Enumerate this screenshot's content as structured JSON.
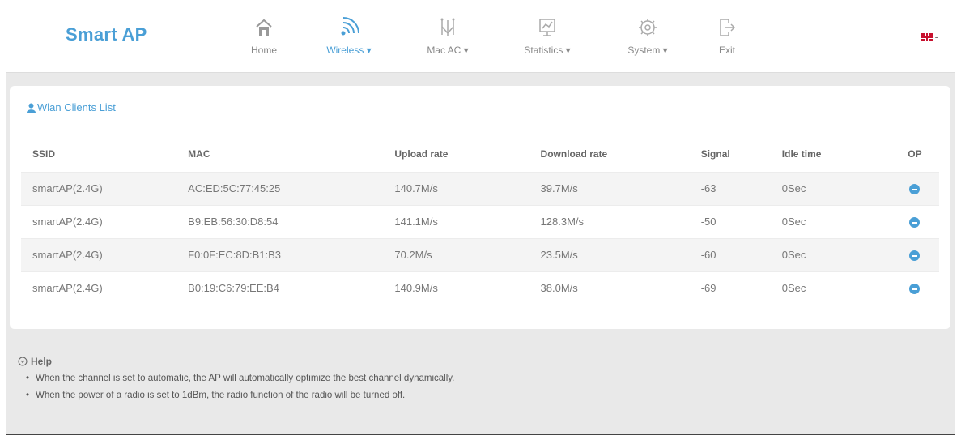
{
  "header": {
    "brand": "Smart AP",
    "nav": [
      {
        "label": "Home",
        "icon": "home-icon"
      },
      {
        "label": "Wireless ▾",
        "icon": "wifi-icon",
        "active": true
      },
      {
        "label": "Mac AC ▾",
        "icon": "antenna-icon"
      },
      {
        "label": "Statistics ▾",
        "icon": "chart-icon"
      },
      {
        "label": "System ▾",
        "icon": "gear-icon"
      },
      {
        "label": "Exit",
        "icon": "exit-icon"
      }
    ],
    "language": "-"
  },
  "clients": {
    "title": "Wlan Clients List",
    "columns": [
      "SSID",
      "MAC",
      "Upload rate",
      "Download rate",
      "Signal",
      "Idle time",
      "OP"
    ],
    "rows": [
      {
        "ssid": "smartAP(2.4G)",
        "mac": "AC:ED:5C:77:45:25",
        "upload": "140.7M/s",
        "download": "39.7M/s",
        "signal": "-63",
        "idle": "0Sec"
      },
      {
        "ssid": "smartAP(2.4G)",
        "mac": "B9:EB:56:30:D8:54",
        "upload": "141.1M/s",
        "download": "128.3M/s",
        "signal": "-50",
        "idle": "0Sec"
      },
      {
        "ssid": "smartAP(2.4G)",
        "mac": "F0:0F:EC:8D:B1:B3",
        "upload": "70.2M/s",
        "download": "23.5M/s",
        "signal": "-60",
        "idle": "0Sec"
      },
      {
        "ssid": "smartAP(2.4G)",
        "mac": "B0:19:C6:79:EE:B4",
        "upload": "140.9M/s",
        "download": "38.0M/s",
        "signal": "-69",
        "idle": "0Sec"
      }
    ]
  },
  "help": {
    "title": "Help",
    "items": [
      "When the channel is set to automatic, the AP will automatically optimize the best channel dynamically.",
      "When the power of a radio is set to 1dBm, the radio function of the radio will be turned off."
    ]
  },
  "colors": {
    "accent": "#4a9fd6"
  }
}
